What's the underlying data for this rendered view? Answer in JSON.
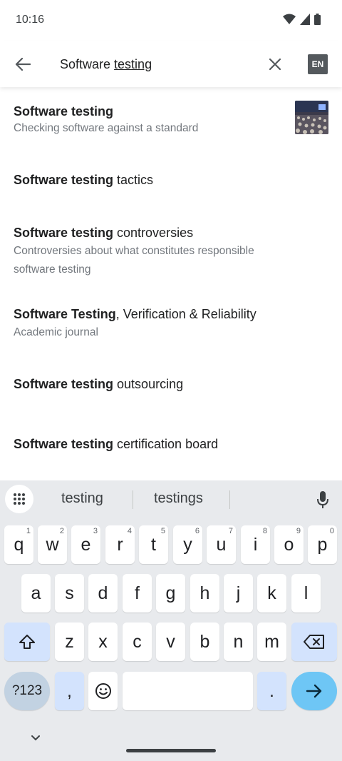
{
  "status_bar": {
    "time": "10:16"
  },
  "search": {
    "query_prefix": "Software ",
    "query_underlined": "testing",
    "lang_badge": "EN"
  },
  "results": [
    {
      "bold": "Software testing",
      "rest": "",
      "description": "Checking software against a standard",
      "has_thumbnail": true
    },
    {
      "bold": "Software testing",
      "rest": " tactics",
      "description": ""
    },
    {
      "bold": "Software testing",
      "rest": " controversies",
      "description": "Controversies about what constitutes responsible software testing"
    },
    {
      "bold": "Software Testing",
      "rest": ", Verification & Reliability",
      "description": "Academic journal"
    },
    {
      "bold": "Software testing",
      "rest": " outsourcing",
      "description": ""
    },
    {
      "bold": "Software testing",
      "rest": " certification board",
      "description": ""
    }
  ],
  "keyboard": {
    "suggestions": [
      "testing",
      "testings"
    ],
    "row1": [
      {
        "k": "q",
        "h": "1"
      },
      {
        "k": "w",
        "h": "2"
      },
      {
        "k": "e",
        "h": "3"
      },
      {
        "k": "r",
        "h": "4"
      },
      {
        "k": "t",
        "h": "5"
      },
      {
        "k": "y",
        "h": "6"
      },
      {
        "k": "u",
        "h": "7"
      },
      {
        "k": "i",
        "h": "8"
      },
      {
        "k": "o",
        "h": "9"
      },
      {
        "k": "p",
        "h": "0"
      }
    ],
    "row2": [
      "a",
      "s",
      "d",
      "f",
      "g",
      "h",
      "j",
      "k",
      "l"
    ],
    "row3": [
      "z",
      "x",
      "c",
      "v",
      "b",
      "n",
      "m"
    ],
    "symbols_label": "?123",
    "comma": ",",
    "period": "."
  },
  "colors": {
    "accent_enter": "#6ec6f5",
    "special_key": "#d3e3fd",
    "lang_badge_bg": "#54595d",
    "description_text": "#72777d"
  }
}
